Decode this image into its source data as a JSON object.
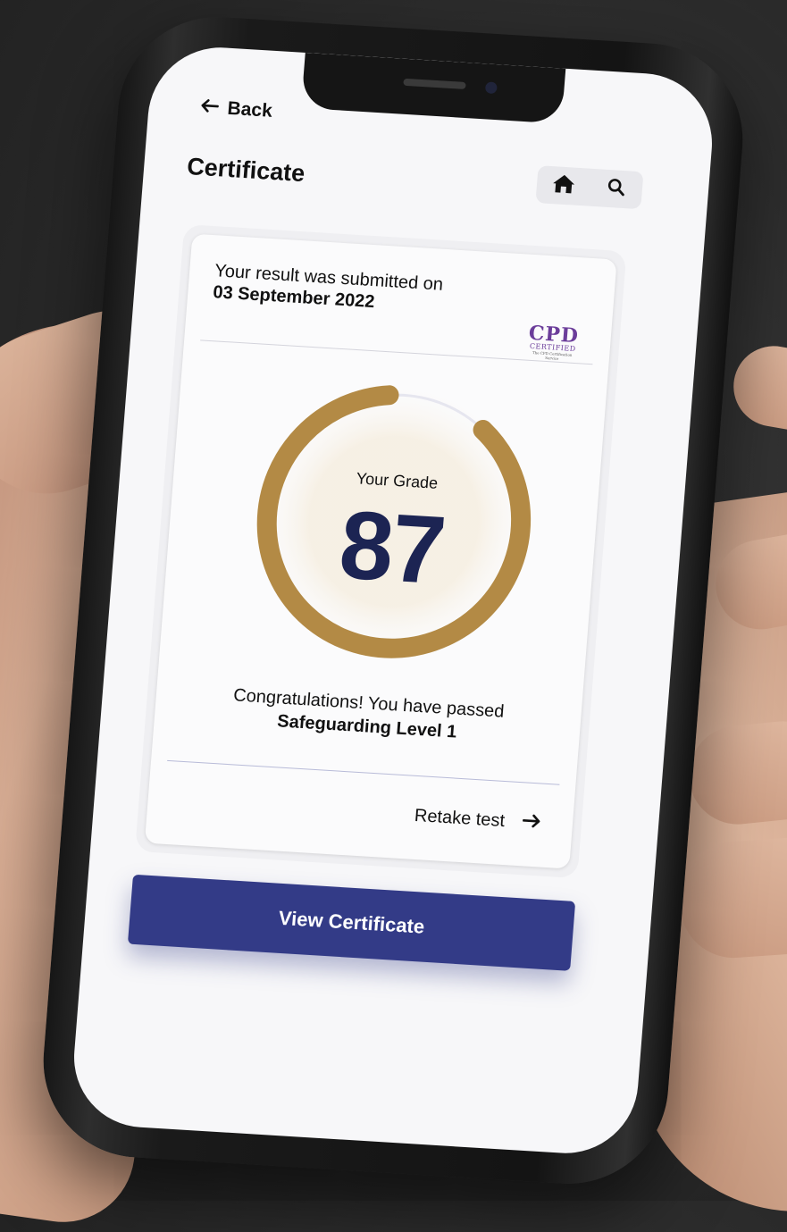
{
  "nav": {
    "back_label": "Back"
  },
  "page": {
    "title": "Certificate"
  },
  "toolbar": {
    "home_icon": "home-icon",
    "search_icon": "search-icon"
  },
  "result": {
    "submitted_text": "Your result was submitted on",
    "submitted_date": "03 September 2022"
  },
  "badge": {
    "line1": "CPD",
    "line2": "CERTIFIED",
    "line3": "The CPD Certification Service"
  },
  "grade": {
    "label": "Your Grade",
    "value": "87",
    "fraction": 0.87,
    "color": "#b38a45",
    "track_color": "#e6e6ef"
  },
  "message": {
    "congrats": "Congratulations! You have passed",
    "course": "Safeguarding Level 1"
  },
  "actions": {
    "retake_label": "Retake test",
    "view_certificate_label": "View Certificate",
    "primary_color": "#333b87"
  }
}
